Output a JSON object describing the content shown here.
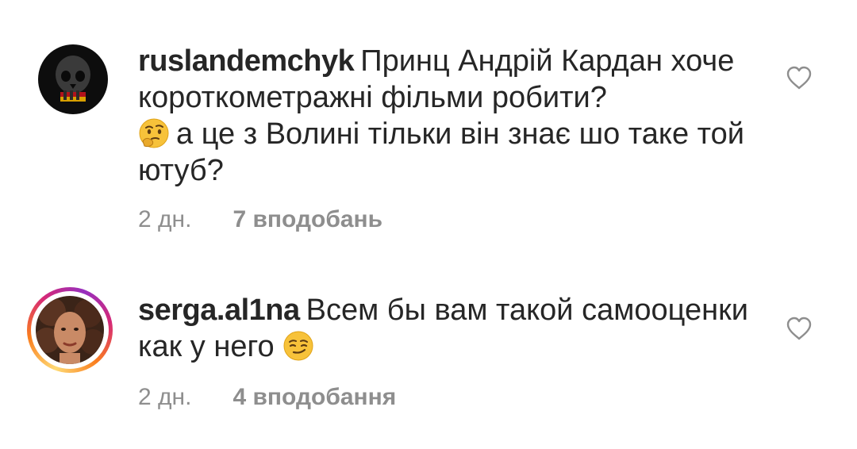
{
  "comments": [
    {
      "username": "ruslandemchyk",
      "text_part1": "Принц Андрій Кардан хоче короткометражні фільми робити?",
      "emoji1": "thinking-face-emoji",
      "text_part2": "а це з Волині тільки він знає шо таке той ютуб?",
      "time": "2 дн.",
      "likes": "7 вподобань",
      "avatar": "skull-avatar"
    },
    {
      "username": "serga.al1na",
      "text_part1": "Всем бы вам такой самооценки как у него",
      "emoji1": "smirking-face-emoji",
      "time": "2 дн.",
      "likes": "4 вподобання",
      "avatar": "woman-curly-hair-avatar",
      "has_story_ring": true
    }
  ],
  "colors": {
    "text": "#262626",
    "secondary": "#8e8e8e",
    "heart_outline": "#8e8e8e"
  }
}
